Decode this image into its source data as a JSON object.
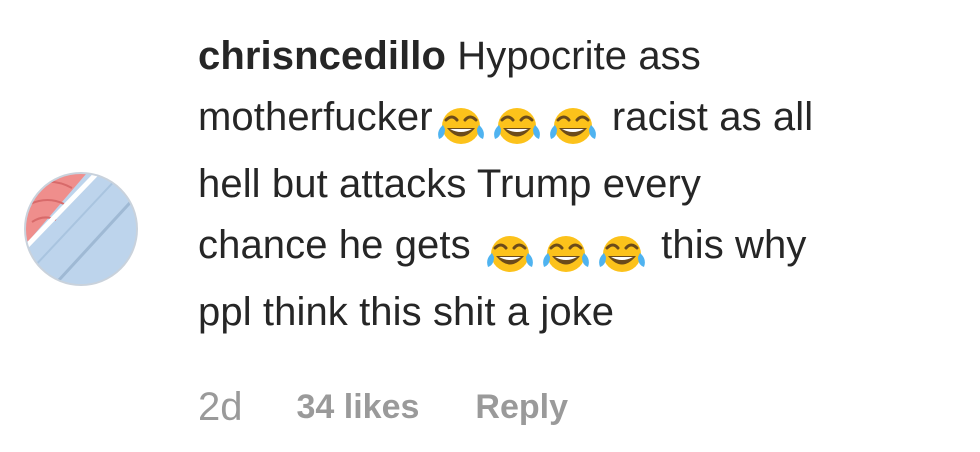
{
  "comment": {
    "username": "chrisncedillo",
    "text_line1": "Hypocrite ass",
    "text_line2_a": "motherfucker",
    "text_line2_b": "racist as all",
    "text_line3": "hell but attacks Trump every",
    "text_line4_a": "chance he gets",
    "text_line4_b": "this why",
    "text_line5": "ppl think this shit a joke",
    "emoji": "face-with-tears-of-joy"
  },
  "meta": {
    "time": "2d",
    "likes": "34 likes",
    "reply": "Reply"
  },
  "colors": {
    "text": "#262626",
    "meta_text": "#9a9a9a",
    "avatar_blue": "#bcd3ea",
    "avatar_red": "#f08f8f"
  }
}
